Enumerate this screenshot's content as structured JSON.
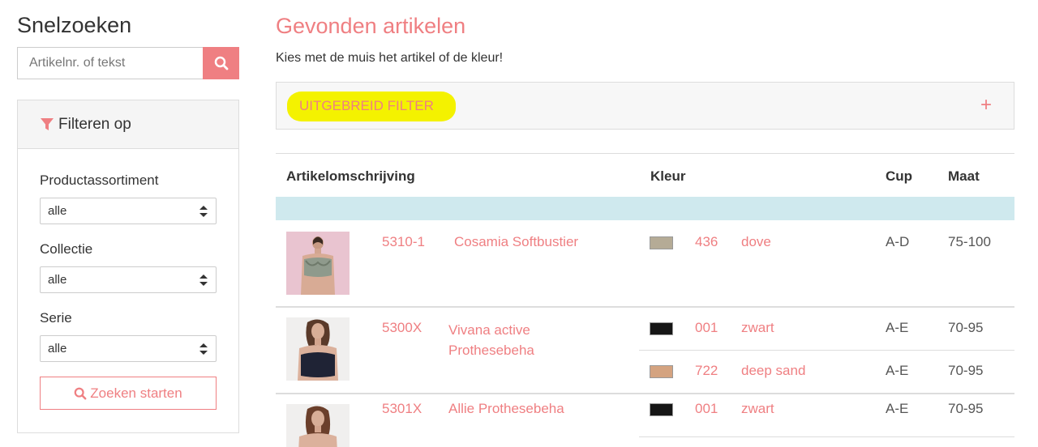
{
  "sidebar": {
    "title": "Snelzoeken",
    "search_placeholder": "Artikelnr. of tekst",
    "filter_title": "Filteren op",
    "filters": [
      {
        "label": "Productassortiment",
        "value": "alle"
      },
      {
        "label": "Collectie",
        "value": "alle"
      },
      {
        "label": "Serie",
        "value": "alle"
      }
    ],
    "start_label": "Zoeken starten"
  },
  "main": {
    "title": "Gevonden artikelen",
    "subtitle": "Kies met de muis het artikel of de kleur!",
    "advanced_filter": "UITGEBREID FILTER",
    "advanced_filter_toggle": "+",
    "columns": [
      "Artikelomschrijving",
      "Kleur",
      "Cup",
      "Maat"
    ],
    "articles": [
      {
        "number": "5310-1",
        "name": "Cosamia Softbustier",
        "variants": [
          {
            "color_code": "436",
            "color_name": "dove",
            "swatch": "#b5ab96",
            "cup": "A-D",
            "size": "75-100"
          }
        ]
      },
      {
        "number": "5300X",
        "name": "Vivana active Prothesebeha",
        "variants": [
          {
            "color_code": "001",
            "color_name": "zwart",
            "swatch": "#161616",
            "cup": "A-E",
            "size": "70-95"
          },
          {
            "color_code": "722",
            "color_name": "deep sand",
            "swatch": "#d4a380",
            "cup": "A-E",
            "size": "70-95"
          }
        ]
      },
      {
        "number": "5301X",
        "name": "Allie Prothesebeha",
        "variants": [
          {
            "color_code": "001",
            "color_name": "zwart",
            "swatch": "#161616",
            "cup": "A-E",
            "size": "70-95"
          }
        ]
      }
    ]
  },
  "colors": {
    "accent": "#ef7f82",
    "highlight": "#f4f200",
    "table_info_row": "#cfe9ee"
  }
}
